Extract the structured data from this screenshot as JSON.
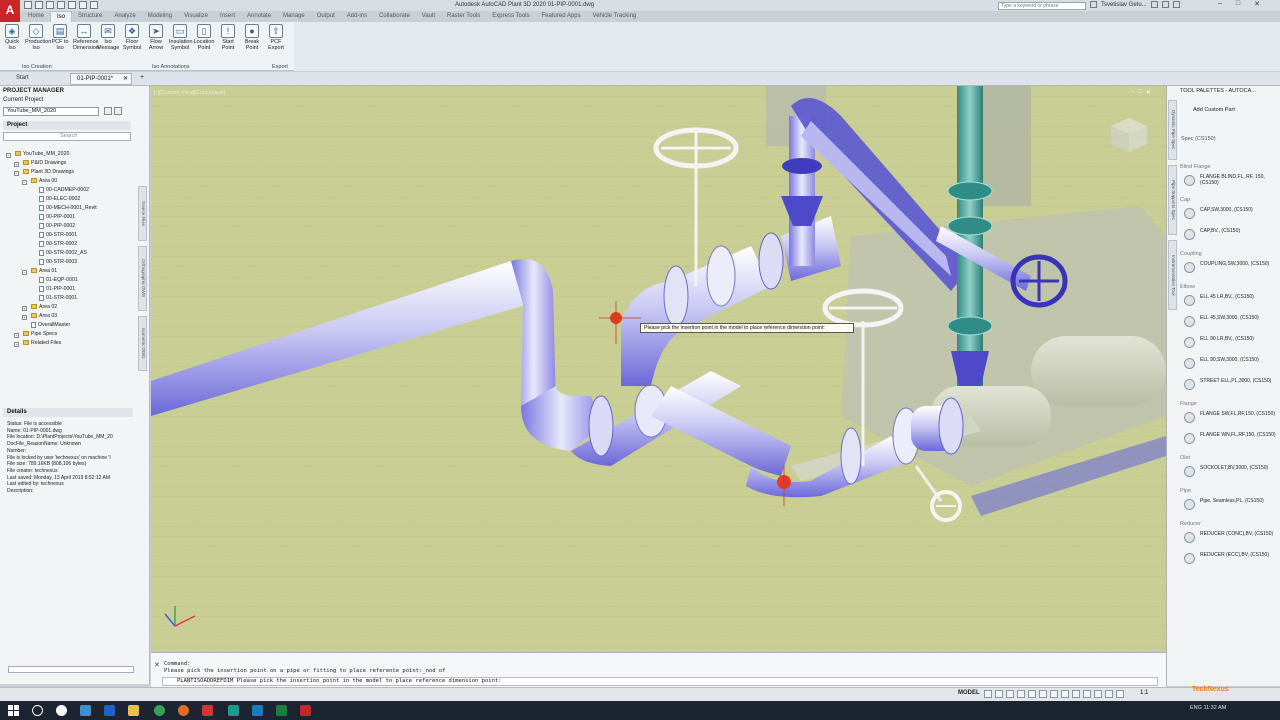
{
  "titlebar": {
    "app_letter": "A",
    "title": "Autodesk AutoCAD Plant 3D 2020   01-PIP-0001.dwg",
    "search_placeholder": "Type a keyword or phrase",
    "user": "Tsvetislav Getu...",
    "window_controls": [
      "–",
      "□",
      "✕"
    ]
  },
  "ribbon": {
    "tabs": [
      "Home",
      "Iso",
      "Structure",
      "Analyze",
      "Modeling",
      "Visualize",
      "Insert",
      "Annotate",
      "Manage",
      "Output",
      "Add-ins",
      "Collaborate",
      "Vault",
      "Raster Tools",
      "Express Tools",
      "Featured Apps",
      "Vehicle Tracking"
    ],
    "active_tab": "Iso",
    "buttons": [
      {
        "label": "Quick Iso",
        "icon": "quick-iso-icon",
        "glyph": "◈"
      },
      {
        "label": "Production Iso",
        "icon": "production-iso-icon",
        "glyph": "◇"
      },
      {
        "label": "PCF to Iso",
        "icon": "pcf-to-iso-icon",
        "glyph": "▤"
      },
      {
        "label": "Reference Dimension",
        "icon": "reference-dimension-icon",
        "glyph": "↔"
      },
      {
        "label": "Iso Message",
        "icon": "iso-message-icon",
        "glyph": "✉"
      },
      {
        "label": "Floor Symbol",
        "icon": "floor-symbol-icon",
        "glyph": "❖"
      },
      {
        "label": "Flow Arrow",
        "icon": "flow-arrow-icon",
        "glyph": "➤"
      },
      {
        "label": "Insulation Symbol",
        "icon": "insulation-symbol-icon",
        "glyph": "▭"
      },
      {
        "label": "Location Point",
        "icon": "location-point-icon",
        "glyph": "▯"
      },
      {
        "label": "Start Point",
        "icon": "start-point-icon",
        "glyph": "!"
      },
      {
        "label": "Break Point",
        "icon": "break-point-icon",
        "glyph": "●"
      },
      {
        "label": "PCF Export",
        "icon": "pcf-export-icon",
        "glyph": "⇧"
      }
    ],
    "panels": [
      "Iso Creation",
      "Iso Annotations",
      "Export"
    ]
  },
  "doc_tabs": {
    "start": "Start",
    "active": "01-PIP-0001*",
    "add": "+"
  },
  "project_manager": {
    "header": "PROJECT MANAGER",
    "current_project_label": "Current Project",
    "current_project": "YouTube_MM_2020",
    "project_header": "Project",
    "search_placeholder": "Search",
    "side_tabs": [
      "Source Files",
      "Orthographic DWG",
      "Isometric DWG"
    ],
    "tree": [
      {
        "label": "YouTube_MM_2020",
        "level": 0,
        "type": "root",
        "tw": "−"
      },
      {
        "label": "P&ID Drawings",
        "level": 1,
        "type": "folder",
        "tw": "+"
      },
      {
        "label": "Plant 3D Drawings",
        "level": 1,
        "type": "folder",
        "tw": "−"
      },
      {
        "label": "Area 00",
        "level": 2,
        "type": "folder",
        "tw": "−"
      },
      {
        "label": "00-CADMEP-0002",
        "level": 3,
        "type": "doc",
        "tw": ""
      },
      {
        "label": "00-ELEC-0002",
        "level": 3,
        "type": "doc",
        "tw": ""
      },
      {
        "label": "00-MECH-0001_Revit",
        "level": 3,
        "type": "doc",
        "tw": ""
      },
      {
        "label": "00-PIP-0001",
        "level": 3,
        "type": "doc",
        "tw": ""
      },
      {
        "label": "00-PIP-0002",
        "level": 3,
        "type": "doc",
        "tw": ""
      },
      {
        "label": "00-STR-0001",
        "level": 3,
        "type": "doc",
        "tw": ""
      },
      {
        "label": "00-STR-0002",
        "level": 3,
        "type": "doc",
        "tw": ""
      },
      {
        "label": "00-STR-0002_AS",
        "level": 3,
        "type": "doc",
        "tw": ""
      },
      {
        "label": "00-STR-0003",
        "level": 3,
        "type": "doc",
        "tw": ""
      },
      {
        "label": "Area 01",
        "level": 2,
        "type": "folder",
        "tw": "−"
      },
      {
        "label": "01-EQP-0001",
        "level": 3,
        "type": "doc",
        "tw": ""
      },
      {
        "label": "01-PIP-0001",
        "level": 3,
        "type": "doc",
        "tw": ""
      },
      {
        "label": "01-STR-0001",
        "level": 3,
        "type": "doc",
        "tw": ""
      },
      {
        "label": "Area 02",
        "level": 2,
        "type": "folder",
        "tw": "+"
      },
      {
        "label": "Area 03",
        "level": 2,
        "type": "folder",
        "tw": "+"
      },
      {
        "label": "OverallMaster",
        "level": 2,
        "type": "doc",
        "tw": ""
      },
      {
        "label": "Pipe Specs",
        "level": 1,
        "type": "folder",
        "tw": "+"
      },
      {
        "label": "Related Files",
        "level": 1,
        "type": "folder",
        "tw": "+"
      }
    ],
    "details_header": "Details",
    "details": [
      "Status: File is accessible",
      "Name: 01-PIP-0001.dwg",
      "File location: D:\\PlantProjects\\YouTube_MM_20",
      "DocFile_ReasonName: Unknown",
      "Number:",
      "File is locked by user 'technexus' on machine 'I",
      "File size: 789.16KB (808,106 bytes)",
      "File creator: technexus",
      "Last saved: Monday, 13 April 2019 8:52:12 AM",
      "Last edited by: technexus",
      "Description:"
    ]
  },
  "viewport": {
    "label": "[-][Custom View][Conceptual]",
    "controls": [
      "–",
      "□",
      "✕"
    ],
    "tooltip": "Please pick the insertion point in the model to place reference dimension point:"
  },
  "command": {
    "close": "✕",
    "line1": "Command:",
    "line2": "Please pick the insertion point on a pipe or fitting to place reference point:_nod of",
    "input": "PLANTISOADDREFDIM Please pick the insertion point in the model to place reference dimension point:"
  },
  "tool_palette": {
    "title": "TOOL PALETTES - AUTOCA...",
    "side_tabs": [
      "Dynamic Pipe Spec",
      "Pipe Supports Spec",
      "Instrumentation Tool"
    ],
    "add_custom": "Add Custom Part",
    "spec": "Spec (CS150)",
    "groups": [
      {
        "name": "Blind Flange",
        "items": [
          "FLANGE BLIND,FL, RF, 150, (CS150)"
        ]
      },
      {
        "name": "Cap",
        "items": [
          "CAP,SW,3000, (CS150)",
          "CAP,BV., (CS150)"
        ]
      },
      {
        "name": "Coupling",
        "items": [
          "COUPLING,SW,3000, (CS150)"
        ]
      },
      {
        "name": "Elbow",
        "items": [
          "ELL 45 LR,BV,, (CS150)",
          "ELL 45,SW,3000, (CS150)",
          "ELL 90 LR,BV,, (CS150)",
          "ELL 90,SW,3000, (CS150)",
          "STREET ELL,PL,3000, (CS150)"
        ]
      },
      {
        "name": "Flange",
        "items": [
          "FLANGE SW,FL,RF,150, (CS150)",
          "FLANGE WN,FL,RF,150, (CS150)"
        ]
      },
      {
        "name": "Olet",
        "items": [
          "SOCKOLET,BV,3000, (CS150)"
        ]
      },
      {
        "name": "Pipe",
        "items": [
          "Pipe, Seamless,PL, (CS150)"
        ]
      },
      {
        "name": "Reducer",
        "items": [
          "REDUCER (CONC),BV, (CS150)",
          "REDUCER (ECC),BV, (CS150)"
        ]
      }
    ]
  },
  "statusbar": {
    "model": "MODEL",
    "scale": "1:1"
  },
  "taskbar": {
    "tray": "ENG  11:32 AM"
  },
  "watermark": "TechNexus"
}
